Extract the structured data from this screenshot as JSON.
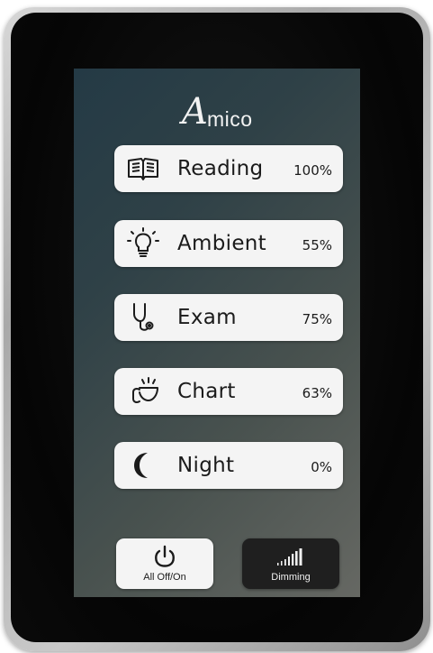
{
  "logo": {
    "letter": "A",
    "rest": "mico"
  },
  "modes": [
    {
      "label": "Reading",
      "value": "100%",
      "icon": "book-icon"
    },
    {
      "label": "Ambient",
      "value": "55%",
      "icon": "lightbulb-icon"
    },
    {
      "label": "Exam",
      "value": "75%",
      "icon": "stethoscope-icon"
    },
    {
      "label": "Chart",
      "value": "63%",
      "icon": "hand-lamp-icon"
    },
    {
      "label": "Night",
      "value": "0%",
      "icon": "moon-icon"
    }
  ],
  "controls": {
    "all_off_on": {
      "label": "All Off/On",
      "icon": "power-icon"
    },
    "dimming": {
      "label": "Dimming",
      "icon": "signal-bars-icon"
    }
  },
  "colors": {
    "button_light": "#f4f4f4",
    "button_dark": "#1f1f1f",
    "text_dark": "#1b1b1b",
    "screen_gradient_start": "#243a45",
    "screen_gradient_end": "#666863"
  }
}
